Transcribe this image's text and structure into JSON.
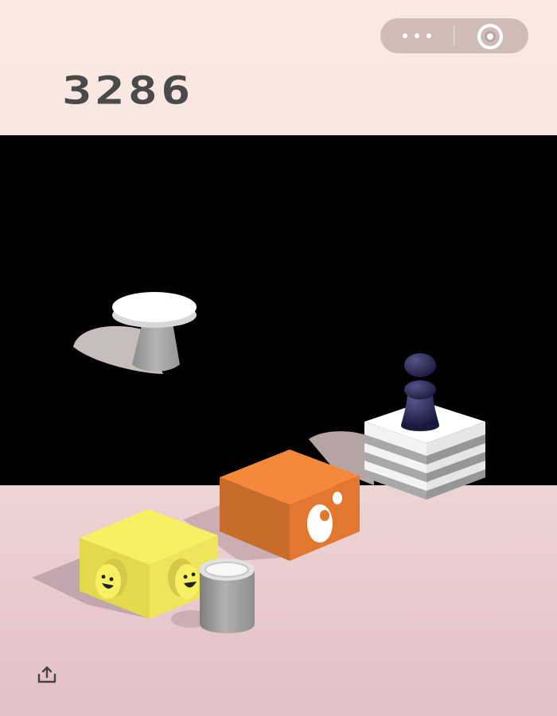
{
  "hud": {
    "score": "3286"
  },
  "capsule_menu": {
    "more_icon": "more-dots-icon",
    "close_icon": "target-circle-icon"
  },
  "share": {
    "icon": "share-upload-icon"
  },
  "scene": {
    "platforms": [
      {
        "kind": "round-pedestal",
        "color": "#ffffff"
      },
      {
        "kind": "striped-cube",
        "color": "#f2f2f2"
      },
      {
        "kind": "orange-cube",
        "color": "#f58a3a"
      },
      {
        "kind": "yellow-smiley-cube",
        "color": "#f7f062"
      },
      {
        "kind": "grey-cylinder",
        "color": "#9d9d9d"
      }
    ],
    "player": {
      "kind": "chess-pawn",
      "color": "#2a2a55"
    }
  }
}
